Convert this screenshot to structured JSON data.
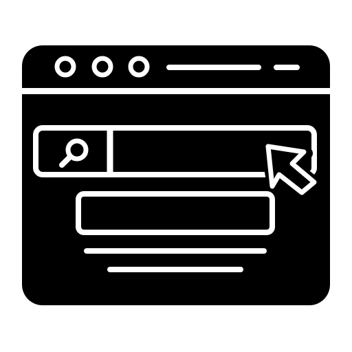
{
  "icon": {
    "name": "web-search-browser-icon",
    "foreground": "#000000",
    "background": "#ffffff",
    "parts": {
      "window": "browser-window",
      "window_controls": [
        "circle",
        "circle",
        "circle"
      ],
      "address_lines": [
        "line",
        "line"
      ],
      "search_bar": "search-bar",
      "search_icon": "magnifier-icon",
      "cursor_icon": "arrow-cursor-icon",
      "result_box": "result-box",
      "text_lines": [
        "line",
        "line"
      ]
    }
  }
}
